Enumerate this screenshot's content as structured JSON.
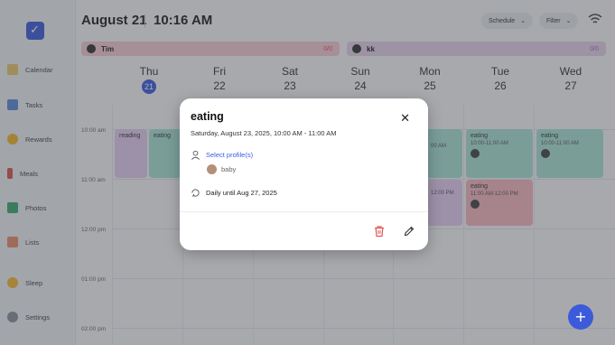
{
  "header": {
    "date": "August 21",
    "time": "10:16 AM",
    "schedule_label": "Schedule",
    "filter_label": "Filter"
  },
  "sidebar": {
    "items": [
      {
        "label": "Calendar",
        "icon": "calendar-icon"
      },
      {
        "label": "Tasks",
        "icon": "tasks-icon"
      },
      {
        "label": "Rewards",
        "icon": "rewards-icon"
      },
      {
        "label": "Meals",
        "icon": "meals-icon"
      },
      {
        "label": "Photos",
        "icon": "photos-icon"
      },
      {
        "label": "Lists",
        "icon": "lists-icon"
      },
      {
        "label": "Sleep",
        "icon": "sleep-icon"
      },
      {
        "label": "Settings",
        "icon": "settings-icon"
      }
    ]
  },
  "profiles": [
    {
      "name": "Tim",
      "count": "0/0",
      "color": "#f3c9cf"
    },
    {
      "name": "kk",
      "count": "0/0",
      "color": "#e4cfe9"
    }
  ],
  "days": [
    {
      "name": "Thu",
      "date": "21",
      "today": true
    },
    {
      "name": "Fri",
      "date": "22"
    },
    {
      "name": "Sat",
      "date": "23"
    },
    {
      "name": "Sun",
      "date": "24"
    },
    {
      "name": "Mon",
      "date": "25"
    },
    {
      "name": "Tue",
      "date": "26"
    },
    {
      "name": "Wed",
      "date": "27"
    }
  ],
  "times": [
    "10:00 am",
    "11:00 am",
    "12:00 pm",
    "01:00 pm",
    "02:00 pm"
  ],
  "events": {
    "reading": "reading",
    "eating_thu": "eating",
    "mon_partial": "00 AM",
    "mon_partial2": "12:00 PM",
    "tue_eating_title": "eating",
    "tue_eating_time": "10:00-11:00 AM",
    "tue_eating2_title": "eating",
    "tue_eating2_time": "11:00 AM-12:00 PM",
    "wed_eating_title": "eating",
    "wed_eating_time": "10:00-11:00 AM"
  },
  "modal": {
    "title": "eating",
    "datetime": "Saturday, August 23, 2025, 10:00 AM - 11:00 AM",
    "select_profiles": "Select profile(s)",
    "profile": "baby",
    "repeat": "Daily until Aug 27, 2025"
  },
  "colors": {
    "accent": "#3b5bdb",
    "teal_event": "#a8e0d2",
    "purple_event": "#e3cbef",
    "red_event": "#f5b4bd",
    "delete": "#e05656"
  }
}
